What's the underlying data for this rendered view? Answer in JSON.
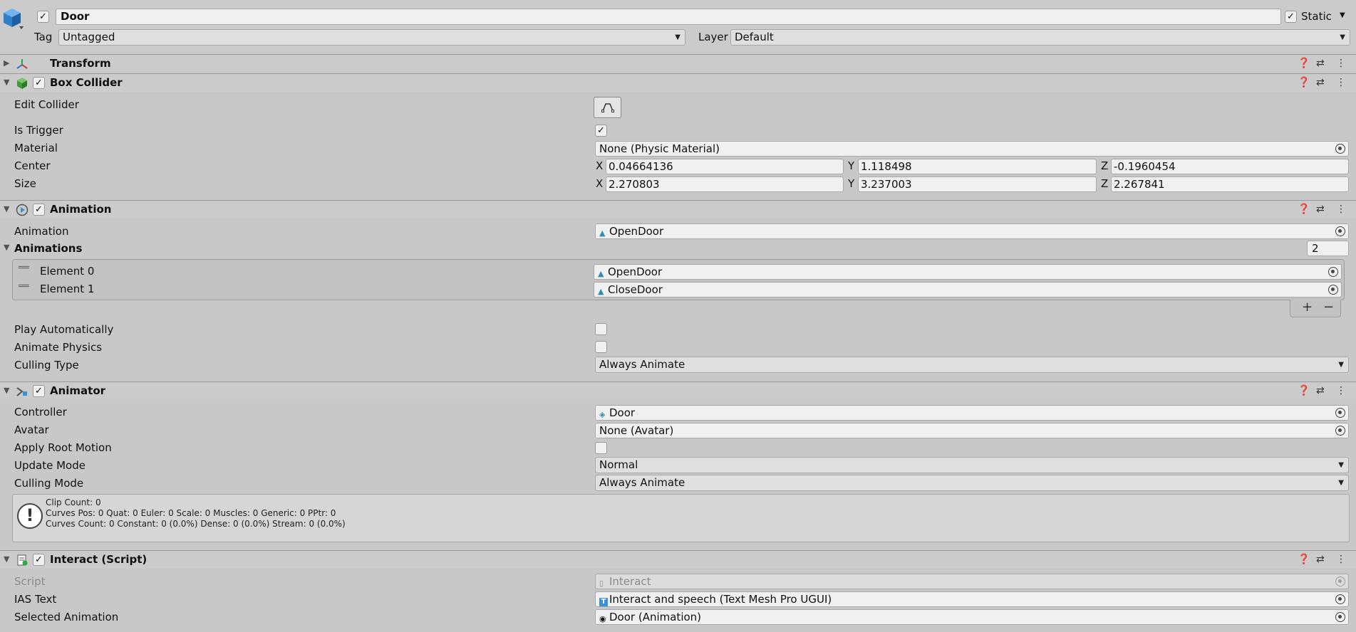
{
  "header": {
    "name": "Door",
    "static_label": "Static",
    "tag_label": "Tag",
    "tag_value": "Untagged",
    "layer_label": "Layer",
    "layer_value": "Default"
  },
  "transform": {
    "title": "Transform"
  },
  "box_collider": {
    "title": "Box Collider",
    "edit_collider": "Edit Collider",
    "is_trigger": "Is Trigger",
    "material_label": "Material",
    "material_value": "None (Physic Material)",
    "center_label": "Center",
    "size_label": "Size",
    "center": {
      "x": "0.04664136",
      "y": "1.118498",
      "z": "-0.1960454"
    },
    "size": {
      "x": "2.270803",
      "y": "3.237003",
      "z": "2.267841"
    },
    "axis_x": "X",
    "axis_y": "Y",
    "axis_z": "Z"
  },
  "animation": {
    "title": "Animation",
    "animation_label": "Animation",
    "animation_value": "OpenDoor",
    "animations_label": "Animations",
    "animations_count": "2",
    "elements": [
      {
        "label": "Element 0",
        "value": "OpenDoor"
      },
      {
        "label": "Element 1",
        "value": "CloseDoor"
      }
    ],
    "plus": "+",
    "minus": "−",
    "play_auto": "Play Automatically",
    "animate_physics": "Animate Physics",
    "culling_type_label": "Culling Type",
    "culling_type_value": "Always Animate"
  },
  "animator": {
    "title": "Animator",
    "controller_label": "Controller",
    "controller_value": "Door",
    "avatar_label": "Avatar",
    "avatar_value": "None (Avatar)",
    "apply_root_motion": "Apply Root Motion",
    "update_mode_label": "Update Mode",
    "update_mode_value": "Normal",
    "culling_mode_label": "Culling Mode",
    "culling_mode_value": "Always Animate",
    "info_lines": [
      "Clip Count: 0",
      "Curves Pos: 0 Quat: 0 Euler: 0 Scale: 0 Muscles: 0 Generic: 0 PPtr: 0",
      "Curves Count: 0 Constant: 0 (0.0%) Dense: 0 (0.0%) Stream: 0 (0.0%)"
    ]
  },
  "interact": {
    "title": "Interact (Script)",
    "script_label": "Script",
    "script_value": "Interact",
    "ias_label": "IAS Text",
    "ias_value": "Interact and speech (Text Mesh Pro UGUI)",
    "selected_anim_label": "Selected Animation",
    "selected_anim_value": "Door (Animation)"
  },
  "colors": {
    "background": "#c8c8c8",
    "field": "#f0f0f0",
    "cube_blue": "#3d8fd6"
  }
}
